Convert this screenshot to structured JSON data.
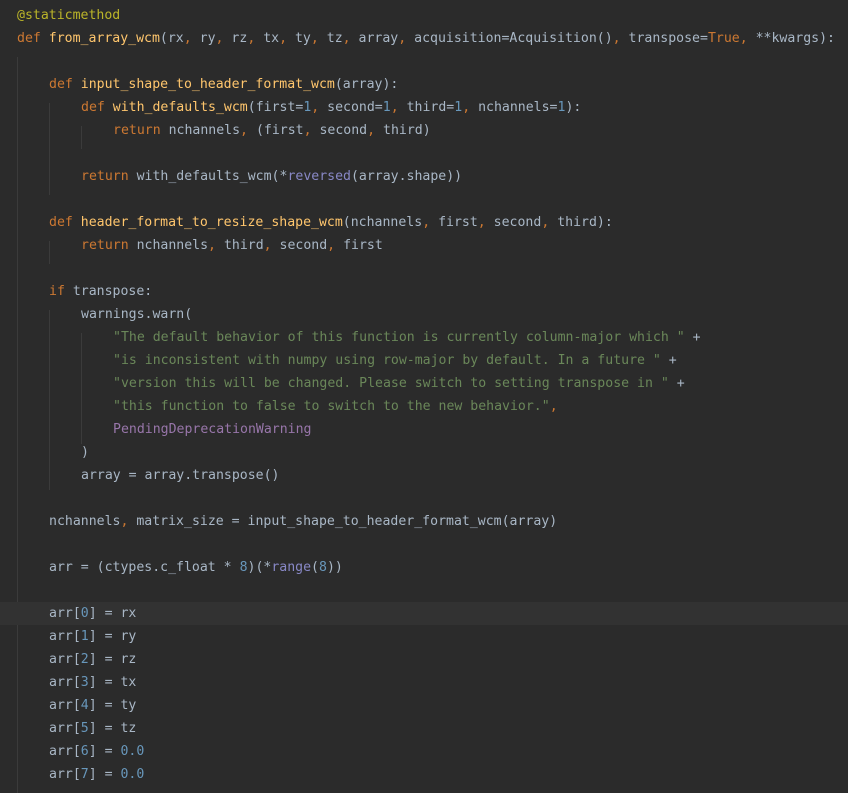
{
  "editor": {
    "colors": {
      "background": "#2b2b2b",
      "current_line": "#323232",
      "default": "#a9b7c6",
      "keyword": "#cc7832",
      "function": "#ffc66d",
      "decorator": "#bbb529",
      "number": "#6897bb",
      "string": "#6a8759",
      "builtin": "#8888c6",
      "class": "#9876aa"
    },
    "current_line_index": 26,
    "lines": [
      {
        "indent": 0,
        "tokens": [
          [
            "dec",
            "@staticmethod"
          ]
        ]
      },
      {
        "indent": 0,
        "tokens": [
          [
            "kw",
            "def "
          ],
          [
            "fn",
            "from_array_wcm"
          ],
          [
            "t",
            "(rx"
          ],
          [
            "c",
            ","
          ],
          [
            "t",
            " ry"
          ],
          [
            "c",
            ","
          ],
          [
            "t",
            " rz"
          ],
          [
            "c",
            ","
          ],
          [
            "t",
            " tx"
          ],
          [
            "c",
            ","
          ],
          [
            "t",
            " ty"
          ],
          [
            "c",
            ","
          ],
          [
            "t",
            " tz"
          ],
          [
            "c",
            ","
          ],
          [
            "t",
            " array"
          ],
          [
            "c",
            ","
          ],
          [
            "t",
            " acquisition=Acquisition()"
          ],
          [
            "c",
            ","
          ],
          [
            "t",
            " transpose="
          ],
          [
            "kw",
            "True"
          ],
          [
            "c",
            ","
          ],
          [
            "t",
            " **kwargs):"
          ]
        ]
      },
      {
        "indent": 0,
        "tokens": []
      },
      {
        "indent": 1,
        "tokens": [
          [
            "kw",
            "def "
          ],
          [
            "fn",
            "input_shape_to_header_format_wcm"
          ],
          [
            "t",
            "(array):"
          ]
        ]
      },
      {
        "indent": 2,
        "tokens": [
          [
            "kw",
            "def "
          ],
          [
            "fn",
            "with_defaults_wcm"
          ],
          [
            "t",
            "(first="
          ],
          [
            "num",
            "1"
          ],
          [
            "c",
            ","
          ],
          [
            "t",
            " second="
          ],
          [
            "num",
            "1"
          ],
          [
            "c",
            ","
          ],
          [
            "t",
            " third="
          ],
          [
            "num",
            "1"
          ],
          [
            "c",
            ","
          ],
          [
            "t",
            " nchannels="
          ],
          [
            "num",
            "1"
          ],
          [
            "t",
            "):"
          ]
        ]
      },
      {
        "indent": 3,
        "tokens": [
          [
            "kw",
            "return "
          ],
          [
            "t",
            "nchannels"
          ],
          [
            "c",
            ","
          ],
          [
            "t",
            " (first"
          ],
          [
            "c",
            ","
          ],
          [
            "t",
            " second"
          ],
          [
            "c",
            ","
          ],
          [
            "t",
            " third)"
          ]
        ]
      },
      {
        "indent": 0,
        "tokens": []
      },
      {
        "indent": 2,
        "tokens": [
          [
            "kw",
            "return "
          ],
          [
            "t",
            "with_defaults_wcm(*"
          ],
          [
            "bi",
            "reversed"
          ],
          [
            "t",
            "(array.shape))"
          ]
        ]
      },
      {
        "indent": 0,
        "tokens": []
      },
      {
        "indent": 1,
        "tokens": [
          [
            "kw",
            "def "
          ],
          [
            "fn",
            "header_format_to_resize_shape_wcm"
          ],
          [
            "t",
            "(nchannels"
          ],
          [
            "c",
            ","
          ],
          [
            "t",
            " first"
          ],
          [
            "c",
            ","
          ],
          [
            "t",
            " second"
          ],
          [
            "c",
            ","
          ],
          [
            "t",
            " third):"
          ]
        ]
      },
      {
        "indent": 2,
        "tokens": [
          [
            "kw",
            "return "
          ],
          [
            "t",
            "nchannels"
          ],
          [
            "c",
            ","
          ],
          [
            "t",
            " third"
          ],
          [
            "c",
            ","
          ],
          [
            "t",
            " second"
          ],
          [
            "c",
            ","
          ],
          [
            "t",
            " first"
          ]
        ]
      },
      {
        "indent": 0,
        "tokens": []
      },
      {
        "indent": 1,
        "tokens": [
          [
            "kw",
            "if "
          ],
          [
            "t",
            "transpose:"
          ]
        ]
      },
      {
        "indent": 2,
        "tokens": [
          [
            "t",
            "warnings.warn("
          ]
        ]
      },
      {
        "indent": 3,
        "tokens": [
          [
            "str",
            "\"The default behavior of this function is currently column-major which \""
          ],
          [
            "t",
            " +"
          ]
        ]
      },
      {
        "indent": 3,
        "tokens": [
          [
            "str",
            "\"is inconsistent with numpy using row-major by default. In a future \""
          ],
          [
            "t",
            " +"
          ]
        ]
      },
      {
        "indent": 3,
        "tokens": [
          [
            "str",
            "\"version this will be changed. Please switch to setting transpose in \""
          ],
          [
            "t",
            " +"
          ]
        ]
      },
      {
        "indent": 3,
        "tokens": [
          [
            "str",
            "\"this function to false to switch to the new behavior.\""
          ],
          [
            "c",
            ","
          ]
        ]
      },
      {
        "indent": 3,
        "tokens": [
          [
            "cls",
            "PendingDeprecationWarning"
          ]
        ]
      },
      {
        "indent": 2,
        "tokens": [
          [
            "t",
            ")"
          ]
        ]
      },
      {
        "indent": 2,
        "tokens": [
          [
            "t",
            "array = array.transpose()"
          ]
        ]
      },
      {
        "indent": 0,
        "tokens": []
      },
      {
        "indent": 1,
        "tokens": [
          [
            "t",
            "nchannels"
          ],
          [
            "c",
            ","
          ],
          [
            "t",
            " matrix_size = input_shape_to_header_format_wcm(array)"
          ]
        ]
      },
      {
        "indent": 0,
        "tokens": []
      },
      {
        "indent": 1,
        "tokens": [
          [
            "t",
            "arr = (ctypes.c_float * "
          ],
          [
            "num",
            "8"
          ],
          [
            "t",
            ")(*"
          ],
          [
            "bi",
            "range"
          ],
          [
            "t",
            "("
          ],
          [
            "num",
            "8"
          ],
          [
            "t",
            "))"
          ]
        ]
      },
      {
        "indent": 0,
        "tokens": []
      },
      {
        "indent": 1,
        "tokens": [
          [
            "t",
            "arr["
          ],
          [
            "num",
            "0"
          ],
          [
            "t",
            "] = rx"
          ]
        ]
      },
      {
        "indent": 1,
        "tokens": [
          [
            "t",
            "arr["
          ],
          [
            "num",
            "1"
          ],
          [
            "t",
            "] = ry"
          ]
        ]
      },
      {
        "indent": 1,
        "tokens": [
          [
            "t",
            "arr["
          ],
          [
            "num",
            "2"
          ],
          [
            "t",
            "] = rz"
          ]
        ]
      },
      {
        "indent": 1,
        "tokens": [
          [
            "t",
            "arr["
          ],
          [
            "num",
            "3"
          ],
          [
            "t",
            "] = tx"
          ]
        ]
      },
      {
        "indent": 1,
        "tokens": [
          [
            "t",
            "arr["
          ],
          [
            "num",
            "4"
          ],
          [
            "t",
            "] = ty"
          ]
        ]
      },
      {
        "indent": 1,
        "tokens": [
          [
            "t",
            "arr["
          ],
          [
            "num",
            "5"
          ],
          [
            "t",
            "] = tz"
          ]
        ]
      },
      {
        "indent": 1,
        "tokens": [
          [
            "t",
            "arr["
          ],
          [
            "num",
            "6"
          ],
          [
            "t",
            "] = "
          ],
          [
            "num",
            "0.0"
          ]
        ]
      },
      {
        "indent": 1,
        "tokens": [
          [
            "t",
            "arr["
          ],
          [
            "num",
            "7"
          ],
          [
            "t",
            "] = "
          ],
          [
            "num",
            "0.0"
          ]
        ]
      }
    ]
  }
}
